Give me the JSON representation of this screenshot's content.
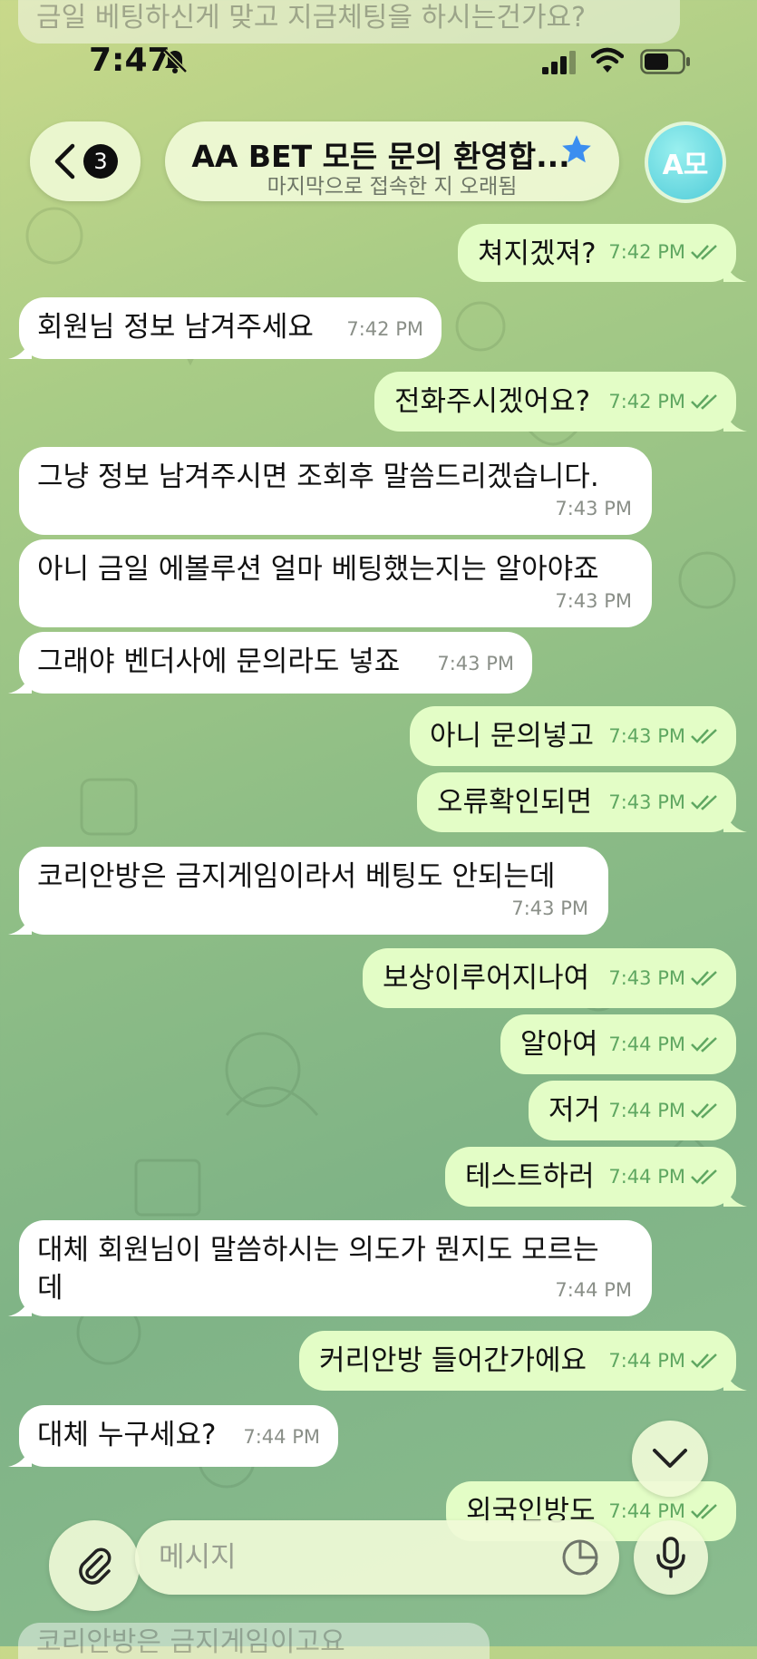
{
  "status_bar": {
    "time": "7:47"
  },
  "header": {
    "back_count": "3",
    "title": "AA BET 모든 문의 환영합...",
    "subtitle": "마지막으로 접속한 지 오래됨",
    "avatar_initials": "A모"
  },
  "faded": {
    "top": "금일 베팅하신게 맞고  지금체팅을 하시는건가요?",
    "bottom": "코리안방은 금지게임이고요"
  },
  "messages": [
    {
      "dir": "out",
      "text": "쳐지겠져?",
      "time": "7:42 PM"
    },
    {
      "dir": "in",
      "text": "회원님 정보 남겨주세요",
      "time": "7:42 PM"
    },
    {
      "dir": "out",
      "text": "전화주시겠어요?",
      "time": "7:42 PM"
    },
    {
      "dir": "in",
      "text": "그냥 정보 남겨주시면 조회후 말씀드리겠습니다.",
      "time": "7:43 PM"
    },
    {
      "dir": "in",
      "text": "아니 금일 에볼루션 얼마 베팅했는지는 알아야죠",
      "time": "7:43 PM"
    },
    {
      "dir": "in",
      "text": "그래야 벤더사에 문의라도 넣죠",
      "time": "7:43 PM"
    },
    {
      "dir": "out",
      "text": "아니 문의넣고",
      "time": "7:43 PM"
    },
    {
      "dir": "out",
      "text": "오류확인되면",
      "time": "7:43 PM"
    },
    {
      "dir": "in",
      "text": "코리안방은 금지게임이라서 베팅도 안되는데",
      "time": "7:43 PM"
    },
    {
      "dir": "out",
      "text": "보상이루어지나여",
      "time": "7:43 PM"
    },
    {
      "dir": "out",
      "text": "알아여",
      "time": "7:44 PM"
    },
    {
      "dir": "out",
      "text": "저거",
      "time": "7:44 PM"
    },
    {
      "dir": "out",
      "text": "테스트하러",
      "time": "7:44 PM"
    },
    {
      "dir": "in",
      "text": "대체 회원님이 말씀하시는 의도가 뭔지도 모르는",
      "text2": "데",
      "time": "7:44 PM"
    },
    {
      "dir": "out",
      "text": "커리안방 들어간가에요",
      "time": "7:44 PM"
    },
    {
      "dir": "in",
      "text": "대체 누구세요?",
      "time": "7:44 PM"
    },
    {
      "dir": "out",
      "text": "외국인방도",
      "time": "7:44 PM"
    }
  ],
  "composer": {
    "placeholder": "메시지"
  },
  "colors": {
    "incoming_bg": "#ffffff",
    "outgoing_bg": "#e3fdc6",
    "outgoing_time": "#5fa761",
    "accent_star": "#3b8ef0"
  }
}
